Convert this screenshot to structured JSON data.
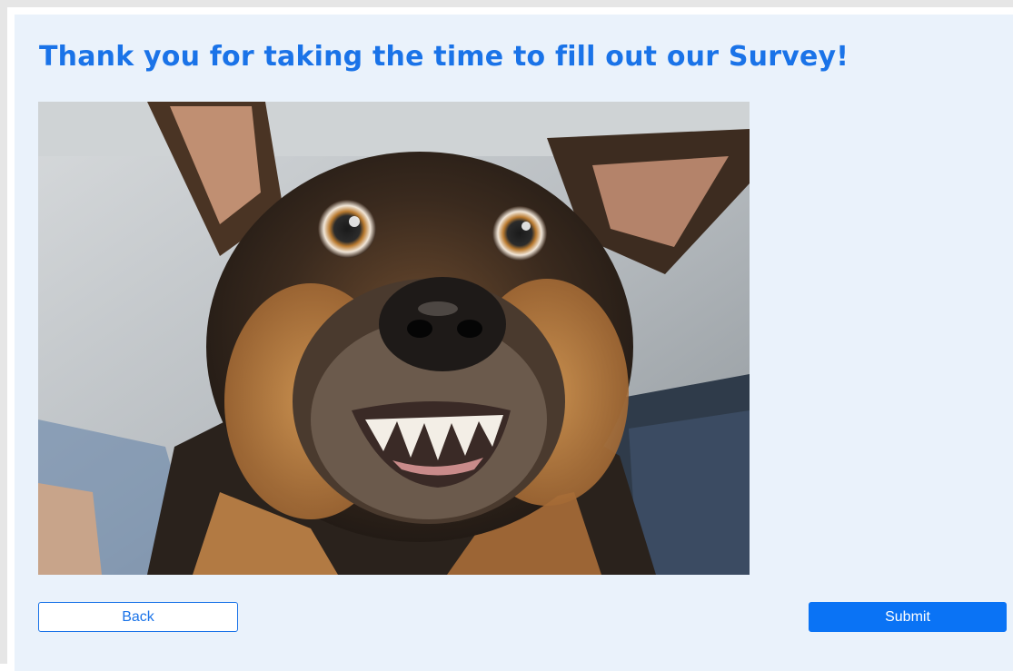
{
  "survey": {
    "thank_you_title": "Thank you for taking the time to fill out our Survey!",
    "image_subject": "dog-photo",
    "buttons": {
      "back_label": "Back",
      "submit_label": "Submit"
    }
  },
  "colors": {
    "accent": "#1a73e8",
    "panel_background": "#eaf2fb",
    "submit_background": "#0a73f5"
  }
}
